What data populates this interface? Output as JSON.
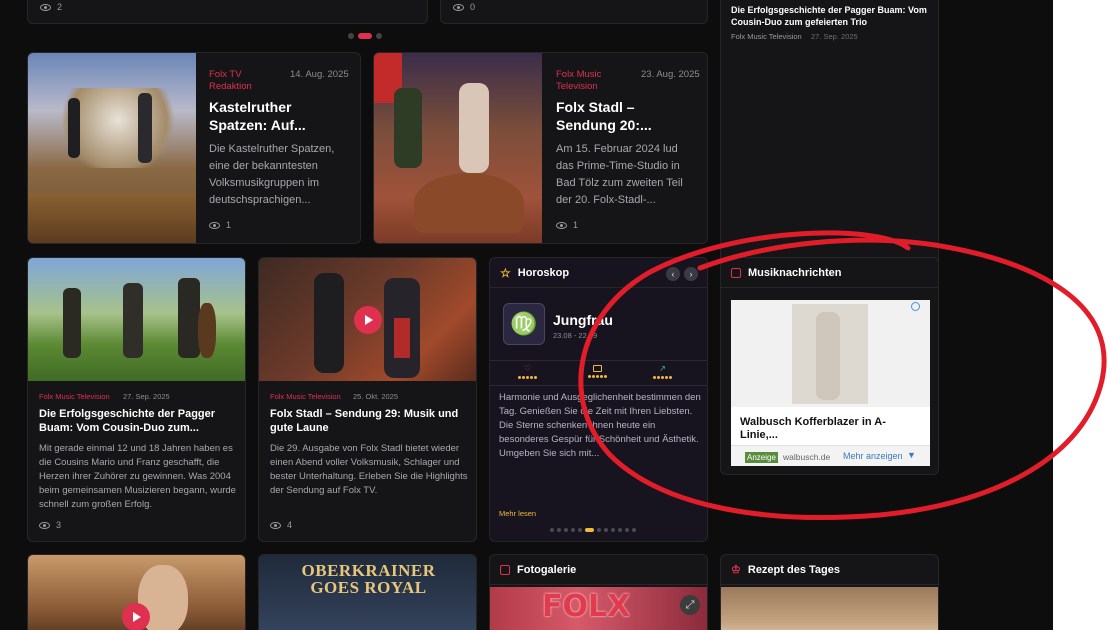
{
  "top_strip": {
    "left_views": "2",
    "right_views": "0"
  },
  "sidebar_top": {
    "title": "Die Erfolgsgeschichte der Pagger Buam: Vom Cousin-Duo zum gefeierten Trio",
    "category": "Folx Music Television",
    "date": "27. Sep. 2025"
  },
  "featured": [
    {
      "category": "Folx TV Redaktion",
      "date": "14. Aug. 2025",
      "title": "Kastelruther Spatzen: Auf...",
      "excerpt": "Die Kastelruther Spatzen, eine der bekanntesten Volksmusikgruppen im deutschsprachigen...",
      "views": "1"
    },
    {
      "category": "Folx Music Television",
      "date": "23. Aug. 2025",
      "title": "Folx Stadl – Sendung 20:...",
      "excerpt": "Am 15. Februar 2024 lud das Prime-Time-Studio in Bad Tölz zum zweiten Teil der 20. Folx-Stadl-...",
      "views": "1"
    }
  ],
  "articles": [
    {
      "category": "Folx Music Television",
      "date": "27. Sep. 2025",
      "title": "Die Erfolgsgeschichte der Pagger Buam: Vom Cousin-Duo zum...",
      "excerpt": "Mit gerade einmal 12 und 18 Jahren haben es die Cousins Mario und Franz geschafft, die Herzen ihrer Zuhörer zu gewinnen. Was 2004 beim gemeinsamen Musizieren begann, wurde schnell zum großen Erfolg.",
      "views": "3"
    },
    {
      "category": "Folx Music Television",
      "date": "25. Okt. 2025",
      "title": "Folx Stadl – Sendung 29: Musik und gute Laune",
      "excerpt": "Die 29. Ausgabe von Folx Stadl bietet wieder einen Abend voller Volksmusik, Schlager und bester Unterhaltung. Erleben Sie die Highlights der Sendung auf Folx TV.",
      "views": "4"
    }
  ],
  "horoscope": {
    "heading": "Horoskop",
    "sign": "Jungfrau",
    "dates": "23.08 - 22.09",
    "text": "Harmonie und Ausgeglichenheit bestimmen den Tag. Genießen Sie die Zeit mit Ihren Liebsten. Die Sterne schenken Ihnen heute ein besonderes Gespür für Schönheit und Ästhetik. Umgeben Sie sich mit...",
    "more": "Mehr lesen",
    "prev_icon": "‹",
    "next_icon": "›",
    "sign_glyph": "♍"
  },
  "music_news": {
    "heading": "Musiknachrichten",
    "ad": {
      "title": "Walbusch Kofferblazer in A-Linie,...",
      "badge": "Anzeige",
      "domain": "walbusch.de",
      "more": "Mehr anzeigen"
    }
  },
  "bottom_row": {
    "oberkrainer_line1": "OBERKRAINER",
    "oberkrainer_line2": "GOES ROYAL",
    "photo_heading": "Fotogalerie",
    "photo_sign": "FOLX",
    "recipe_heading": "Rezept des Tages"
  },
  "colors": {
    "accent": "#e0304f",
    "gold": "#f2b83a",
    "background": "#0d0d0e",
    "annotation": "#e11d2a"
  }
}
